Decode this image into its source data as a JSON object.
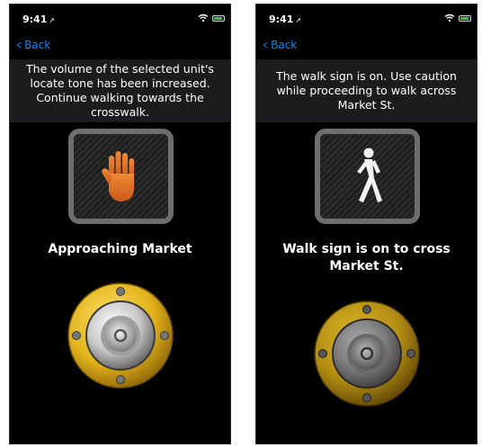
{
  "left_screen": {
    "status_time": "9:41",
    "back_label": "Back",
    "message": "The volume of the selected unit's locate tone has been increased. Continue walking towards the crosswalk.",
    "signal_icon": "stop-hand-icon",
    "caption": "Approaching Market"
  },
  "right_screen": {
    "status_time": "9:41",
    "back_label": "Back",
    "message": "The walk sign is on. Use caution while proceeding to walk across Market St.",
    "signal_icon": "walking-person-icon",
    "caption": "Walk sign is on to cross Market St."
  },
  "colors": {
    "accent": "#0a84ff",
    "hand": "#e8782a",
    "button_gold": "#e2b31c",
    "battery": "#3ec33e"
  }
}
